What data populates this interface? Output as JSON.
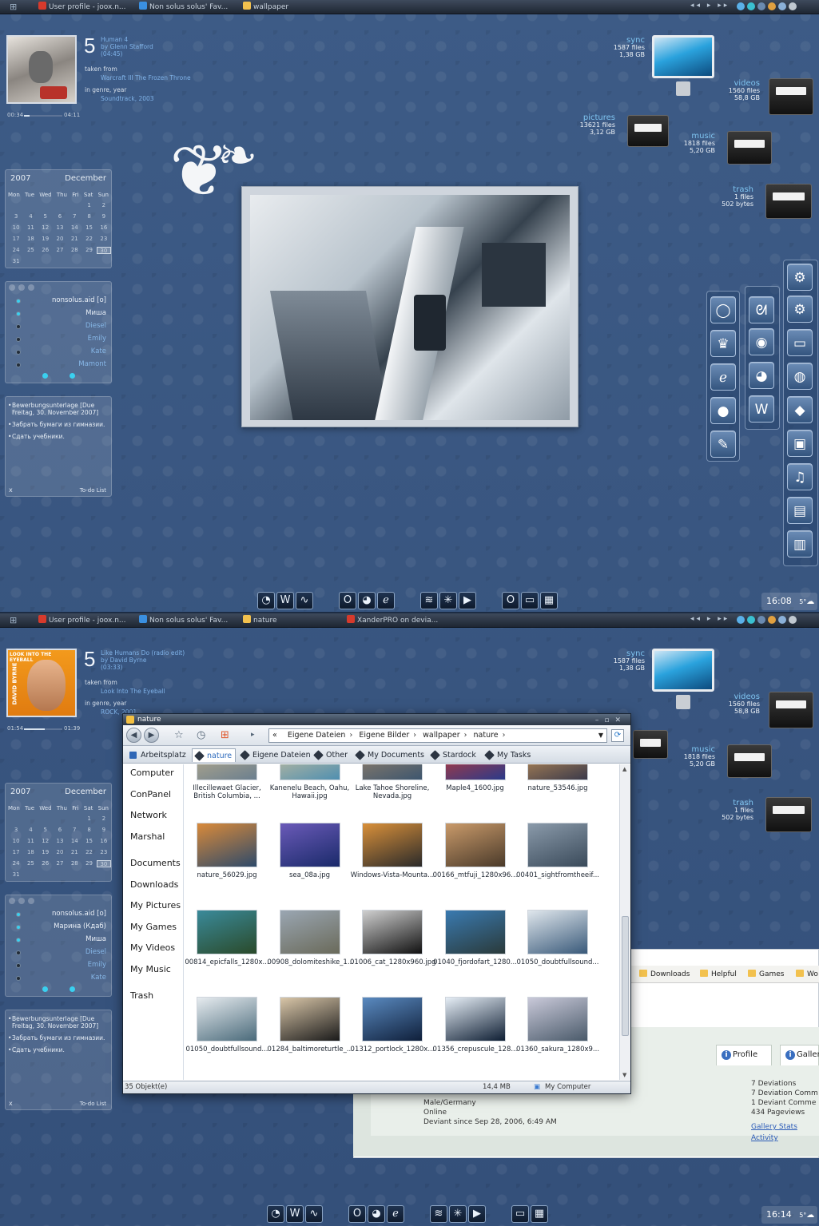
{
  "top": {
    "taskbar": {
      "tasks": [
        {
          "label": "User profile - joox.n...",
          "color": "#d63a2c"
        },
        {
          "label": "Non solus solus' Fav...",
          "color": "#3a8fe0"
        },
        {
          "label": "wallpaper",
          "color": "#f2c14e"
        }
      ],
      "media": "◂◂ ▸ ▸▸"
    },
    "player": {
      "track_number": "5",
      "track_title": "Human 4",
      "artist": "by Glenn Stafford",
      "duration": "(04:45)",
      "taken_from_label": "taken from",
      "album": "Warcraft III The Frozen Throne",
      "genre_year_label": "in genre, year",
      "genre_year": "Soundtrack, 2003",
      "elapsed": "00:34",
      "total": "04:11",
      "progress": 0.14
    },
    "calendar": {
      "year": "2007",
      "month": "December",
      "days_of_week": [
        "Mon",
        "Tue",
        "Wed",
        "Thu",
        "Fri",
        "Sat",
        "Sun"
      ],
      "cells": [
        "",
        "",
        "",
        "",
        "",
        "1",
        "2",
        "3",
        "4",
        "5",
        "6",
        "7",
        "8",
        "9",
        "10",
        "11",
        "12",
        "13",
        "14",
        "15",
        "16",
        "17",
        "18",
        "19",
        "20",
        "21",
        "22",
        "23",
        "24",
        "25",
        "26",
        "27",
        "28",
        "29",
        "30",
        "31"
      ],
      "today": "30"
    },
    "contacts": [
      {
        "name": "nonsolus.aid [o]",
        "online": true
      },
      {
        "name": "Миша",
        "online": true
      },
      {
        "name": "Diesel",
        "online": false
      },
      {
        "name": "Emily",
        "online": false
      },
      {
        "name": "Kate",
        "online": false
      },
      {
        "name": "Mamont",
        "online": false
      }
    ],
    "todo": {
      "items": [
        "Bewerbungsunterlage [Due Freitag, 30. November 2007]",
        "Забрать бумаги из гимназии.",
        "Сдать учебники."
      ],
      "close": "x",
      "label": "To-do List"
    },
    "system": {
      "sync": {
        "title": "sync",
        "files": "1587 files",
        "size": "1,38 GB"
      },
      "videos": {
        "title": "videos",
        "files": "1560 files",
        "size": "58,8 GB"
      },
      "pictures": {
        "title": "pictures",
        "files": "13621 files",
        "size": "3,12 GB"
      },
      "music": {
        "title": "music",
        "files": "1818 files",
        "size": "5,20 GB"
      },
      "trash": {
        "title": "trash",
        "files": "1 files",
        "size": "502 bytes"
      }
    },
    "clock": "16:08",
    "weather": "5°"
  },
  "bottom": {
    "taskbar": {
      "tasks": [
        {
          "label": "User profile - joox.n...",
          "color": "#d63a2c"
        },
        {
          "label": "Non solus solus' Fav...",
          "color": "#3a8fe0"
        },
        {
          "label": "nature",
          "color": "#f2c14e"
        },
        {
          "label": "XanderPRO on devia...",
          "color": "#d63a2c"
        }
      ],
      "media": "◂◂ ▸ ▸▸"
    },
    "player": {
      "track_number": "5",
      "track_title": "Like Humans Do (radio edit)",
      "artist": "by David Byrne",
      "duration": "(03:33)",
      "taken_from_label": "taken from",
      "album": "Look Into The Eyeball",
      "genre_year_label": "in genre, year",
      "genre_year": "ROCK, 2001",
      "elapsed": "01:54",
      "total": "01:39",
      "album_text": "LOOK INTO THE EYEBALL",
      "album_side": "DAVID BYRNE",
      "progress": 0.55
    },
    "calendar": {
      "year": "2007",
      "month": "December",
      "days_of_week": [
        "Mon",
        "Tue",
        "Wed",
        "Thu",
        "Fri",
        "Sat",
        "Sun"
      ],
      "cells": [
        "",
        "",
        "",
        "",
        "",
        "1",
        "2",
        "3",
        "4",
        "5",
        "6",
        "7",
        "8",
        "9",
        "10",
        "11",
        "12",
        "13",
        "14",
        "15",
        "16",
        "17",
        "18",
        "19",
        "20",
        "21",
        "22",
        "23",
        "24",
        "25",
        "26",
        "27",
        "28",
        "29",
        "30",
        "31"
      ],
      "today": "30"
    },
    "contacts": [
      {
        "name": "nonsolus.aid [o]",
        "online": true
      },
      {
        "name": "Марина (Кдаб)",
        "online": true
      },
      {
        "name": "Миша",
        "online": true
      },
      {
        "name": "Diesel",
        "online": false
      },
      {
        "name": "Emily",
        "online": false
      },
      {
        "name": "Kate",
        "online": false
      }
    ],
    "todo": {
      "items": [
        "Bewerbungsunterlage [Due Freitag, 30. November 2007]",
        "Забрать бумаги из гимназии.",
        "Сдать учебники."
      ],
      "close": "x",
      "label": "To-do List"
    },
    "system": {
      "sync": {
        "title": "sync",
        "files": "1587 files",
        "size": "1,38 GB"
      },
      "videos": {
        "title": "videos",
        "files": "1560 files",
        "size": "58,8 GB"
      },
      "music": {
        "title": "music",
        "files": "1818 files",
        "size": "5,20 GB"
      },
      "trash": {
        "title": "trash",
        "files": "1 files",
        "size": "502 bytes"
      }
    },
    "explorer": {
      "title": "nature",
      "address": [
        "«",
        "Eigene Dateien",
        "Eigene Bilder",
        "wallpaper",
        "nature"
      ],
      "tabs": [
        "Arbeitsplatz",
        "nature",
        "Eigene Dateien",
        "Other",
        "My Documents",
        "Stardock",
        "My Tasks"
      ],
      "active_tab": "nature",
      "sidebar": [
        "Computer",
        "ConPanel",
        "Network",
        "Marshal",
        "Documents",
        "Downloads",
        "My Pictures",
        "My Games",
        "My Videos",
        "My Music",
        "Trash"
      ],
      "files": [
        {
          "name": "Illecillewaet Glacier, British Columbia, ...",
          "c1": "#c9b58a",
          "c2": "#6b7f8f"
        },
        {
          "name": "Kanenelu Beach, Oahu, Hawaii.jpg",
          "c1": "#e0c79a",
          "c2": "#4f8fb0"
        },
        {
          "name": "Lake Tahoe Shoreline, Nevada.jpg",
          "c1": "#a88a6a",
          "c2": "#3d566e"
        },
        {
          "name": "Maple4_1600.jpg",
          "c1": "#e03a22",
          "c2": "#2a3a8a"
        },
        {
          "name": "nature_53546.jpg",
          "c1": "#d9a05a",
          "c2": "#3b3a4a"
        },
        {
          "name": "nature_56029.jpg",
          "c1": "#d98a3a",
          "c2": "#2e4a6a"
        },
        {
          "name": "sea_08a.jpg",
          "c1": "#6a5ab8",
          "c2": "#1a2a6a"
        },
        {
          "name": "Windows-Vista-Mounta...",
          "c1": "#d9903a",
          "c2": "#2a2a2a"
        },
        {
          "name": "00166_mtfuji_1280x96...",
          "c1": "#c99a6a",
          "c2": "#4a3a2a"
        },
        {
          "name": "00401_sightfromtheeif...",
          "c1": "#8a9aaa",
          "c2": "#3a4a5a"
        },
        {
          "name": "00814_epicfalls_1280x...",
          "c1": "#3a8a9a",
          "c2": "#2a4a2a"
        },
        {
          "name": "00908_dolomiteshike_1...",
          "c1": "#9aa6b2",
          "c2": "#6a6a5a"
        },
        {
          "name": "01006_cat_1280x960.jpg",
          "c1": "#cfcfcf",
          "c2": "#111111"
        },
        {
          "name": "01040_fjordofart_1280...",
          "c1": "#3a7ab0",
          "c2": "#2a3a3a"
        },
        {
          "name": "01050_doubtfullsound...",
          "c1": "#dfe6ec",
          "c2": "#3a5a7a"
        },
        {
          "name": "01050_doubtfullsound...",
          "c1": "#e6ebef",
          "c2": "#4a6a7a"
        },
        {
          "name": "01284_baltimoreturtle_...",
          "c1": "#d9c6a8",
          "c2": "#1a1a1a"
        },
        {
          "name": "01312_portlock_1280x...",
          "c1": "#5a8ac0",
          "c2": "#0f1f3a"
        },
        {
          "name": "01356_crepuscule_128...",
          "c1": "#e6eef6",
          "c2": "#0e1e33"
        },
        {
          "name": "01360_sakura_1280x9...",
          "c1": "#c9c9d9",
          "c2": "#4a5a6a"
        }
      ],
      "status_count": "35 Objekt(e)",
      "status_size": "14,4 MB",
      "status_location": "My Computer"
    },
    "browser": {
      "bookmarks": [
        "Downloads",
        "Helpful",
        "Games",
        "Wo"
      ],
      "profile_tabs": [
        "Profile",
        "Galler"
      ],
      "profile_lines": [
        "Male/Germany",
        "Online",
        "Deviant since Sep 28, 2006, 6:49 AM"
      ],
      "stats": [
        "7 Deviations",
        "7 Deviation Comm",
        "1 Deviant Comme",
        "434 Pageviews"
      ],
      "links": [
        "Gallery Stats",
        "Activity"
      ]
    },
    "clock": "16:14",
    "weather": "5°"
  }
}
